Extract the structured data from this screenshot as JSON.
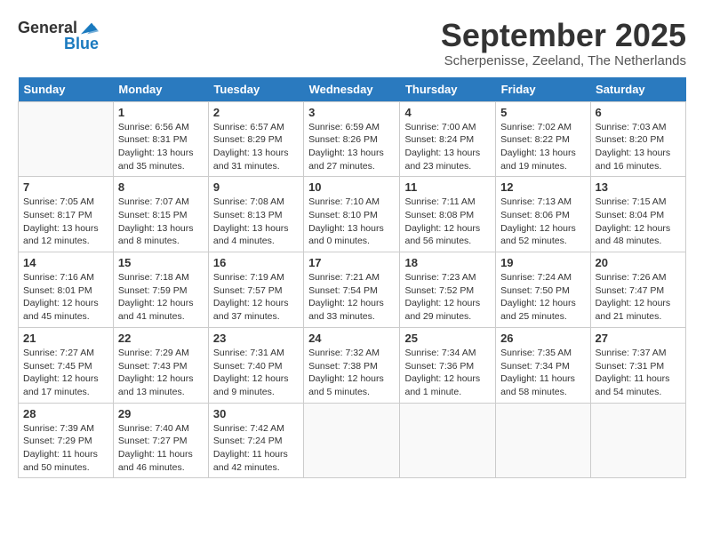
{
  "logo": {
    "general": "General",
    "blue": "Blue"
  },
  "title": "September 2025",
  "subtitle": "Scherpenisse, Zeeland, The Netherlands",
  "days_of_week": [
    "Sunday",
    "Monday",
    "Tuesday",
    "Wednesday",
    "Thursday",
    "Friday",
    "Saturday"
  ],
  "weeks": [
    [
      {
        "day": "",
        "detail": ""
      },
      {
        "day": "1",
        "detail": "Sunrise: 6:56 AM\nSunset: 8:31 PM\nDaylight: 13 hours and 35 minutes."
      },
      {
        "day": "2",
        "detail": "Sunrise: 6:57 AM\nSunset: 8:29 PM\nDaylight: 13 hours and 31 minutes."
      },
      {
        "day": "3",
        "detail": "Sunrise: 6:59 AM\nSunset: 8:26 PM\nDaylight: 13 hours and 27 minutes."
      },
      {
        "day": "4",
        "detail": "Sunrise: 7:00 AM\nSunset: 8:24 PM\nDaylight: 13 hours and 23 minutes."
      },
      {
        "day": "5",
        "detail": "Sunrise: 7:02 AM\nSunset: 8:22 PM\nDaylight: 13 hours and 19 minutes."
      },
      {
        "day": "6",
        "detail": "Sunrise: 7:03 AM\nSunset: 8:20 PM\nDaylight: 13 hours and 16 minutes."
      }
    ],
    [
      {
        "day": "7",
        "detail": "Sunrise: 7:05 AM\nSunset: 8:17 PM\nDaylight: 13 hours and 12 minutes."
      },
      {
        "day": "8",
        "detail": "Sunrise: 7:07 AM\nSunset: 8:15 PM\nDaylight: 13 hours and 8 minutes."
      },
      {
        "day": "9",
        "detail": "Sunrise: 7:08 AM\nSunset: 8:13 PM\nDaylight: 13 hours and 4 minutes."
      },
      {
        "day": "10",
        "detail": "Sunrise: 7:10 AM\nSunset: 8:10 PM\nDaylight: 13 hours and 0 minutes."
      },
      {
        "day": "11",
        "detail": "Sunrise: 7:11 AM\nSunset: 8:08 PM\nDaylight: 12 hours and 56 minutes."
      },
      {
        "day": "12",
        "detail": "Sunrise: 7:13 AM\nSunset: 8:06 PM\nDaylight: 12 hours and 52 minutes."
      },
      {
        "day": "13",
        "detail": "Sunrise: 7:15 AM\nSunset: 8:04 PM\nDaylight: 12 hours and 48 minutes."
      }
    ],
    [
      {
        "day": "14",
        "detail": "Sunrise: 7:16 AM\nSunset: 8:01 PM\nDaylight: 12 hours and 45 minutes."
      },
      {
        "day": "15",
        "detail": "Sunrise: 7:18 AM\nSunset: 7:59 PM\nDaylight: 12 hours and 41 minutes."
      },
      {
        "day": "16",
        "detail": "Sunrise: 7:19 AM\nSunset: 7:57 PM\nDaylight: 12 hours and 37 minutes."
      },
      {
        "day": "17",
        "detail": "Sunrise: 7:21 AM\nSunset: 7:54 PM\nDaylight: 12 hours and 33 minutes."
      },
      {
        "day": "18",
        "detail": "Sunrise: 7:23 AM\nSunset: 7:52 PM\nDaylight: 12 hours and 29 minutes."
      },
      {
        "day": "19",
        "detail": "Sunrise: 7:24 AM\nSunset: 7:50 PM\nDaylight: 12 hours and 25 minutes."
      },
      {
        "day": "20",
        "detail": "Sunrise: 7:26 AM\nSunset: 7:47 PM\nDaylight: 12 hours and 21 minutes."
      }
    ],
    [
      {
        "day": "21",
        "detail": "Sunrise: 7:27 AM\nSunset: 7:45 PM\nDaylight: 12 hours and 17 minutes."
      },
      {
        "day": "22",
        "detail": "Sunrise: 7:29 AM\nSunset: 7:43 PM\nDaylight: 12 hours and 13 minutes."
      },
      {
        "day": "23",
        "detail": "Sunrise: 7:31 AM\nSunset: 7:40 PM\nDaylight: 12 hours and 9 minutes."
      },
      {
        "day": "24",
        "detail": "Sunrise: 7:32 AM\nSunset: 7:38 PM\nDaylight: 12 hours and 5 minutes."
      },
      {
        "day": "25",
        "detail": "Sunrise: 7:34 AM\nSunset: 7:36 PM\nDaylight: 12 hours and 1 minute."
      },
      {
        "day": "26",
        "detail": "Sunrise: 7:35 AM\nSunset: 7:34 PM\nDaylight: 11 hours and 58 minutes."
      },
      {
        "day": "27",
        "detail": "Sunrise: 7:37 AM\nSunset: 7:31 PM\nDaylight: 11 hours and 54 minutes."
      }
    ],
    [
      {
        "day": "28",
        "detail": "Sunrise: 7:39 AM\nSunset: 7:29 PM\nDaylight: 11 hours and 50 minutes."
      },
      {
        "day": "29",
        "detail": "Sunrise: 7:40 AM\nSunset: 7:27 PM\nDaylight: 11 hours and 46 minutes."
      },
      {
        "day": "30",
        "detail": "Sunrise: 7:42 AM\nSunset: 7:24 PM\nDaylight: 11 hours and 42 minutes."
      },
      {
        "day": "",
        "detail": ""
      },
      {
        "day": "",
        "detail": ""
      },
      {
        "day": "",
        "detail": ""
      },
      {
        "day": "",
        "detail": ""
      }
    ]
  ]
}
